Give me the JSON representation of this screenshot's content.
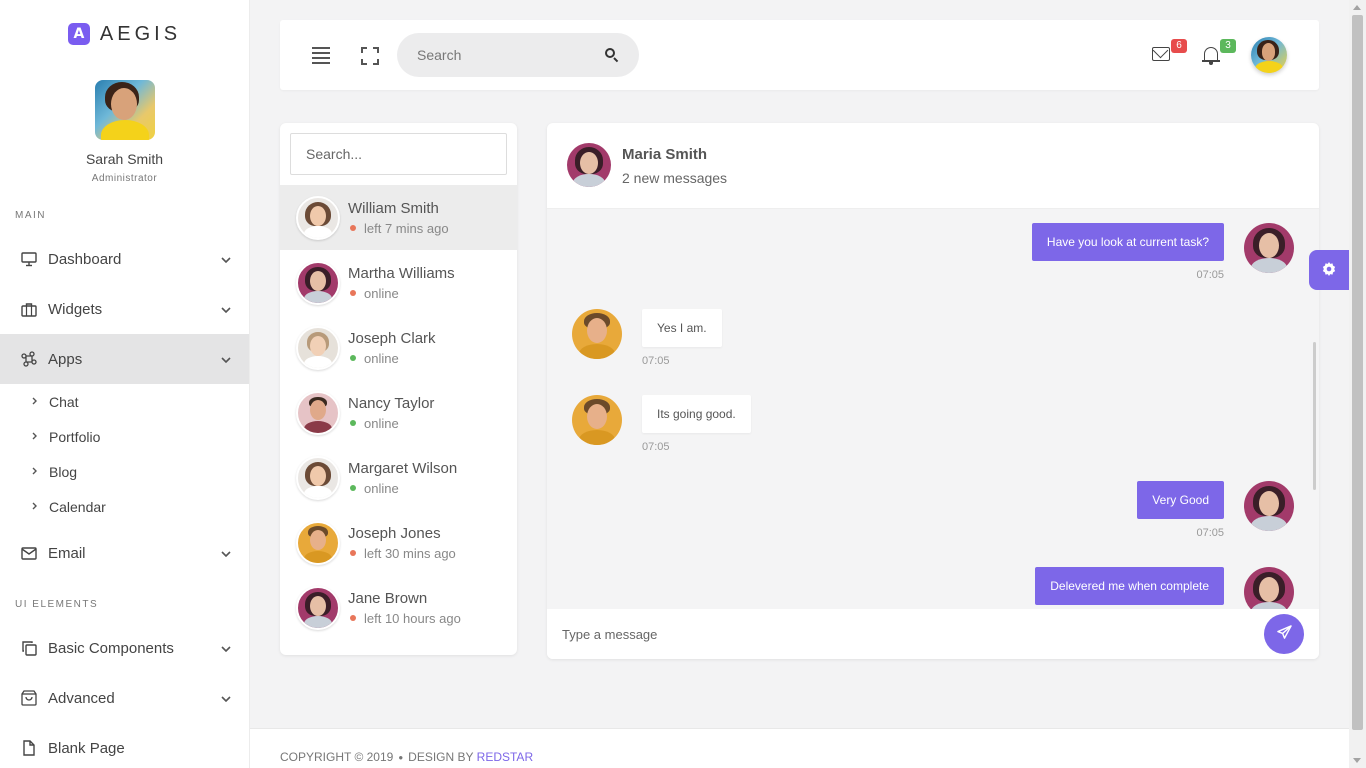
{
  "brand": {
    "logo_letter": "A",
    "name": "AEGIS"
  },
  "profile": {
    "name": "Sarah Smith",
    "role": "Administrator"
  },
  "sidebar": {
    "section_main": "MAIN",
    "section_ui": "UI ELEMENTS",
    "items": [
      {
        "label": "Dashboard",
        "icon": "monitor-icon"
      },
      {
        "label": "Widgets",
        "icon": "briefcase-icon"
      },
      {
        "label": "Apps",
        "icon": "command-icon"
      },
      {
        "label": "Email",
        "icon": "mail-icon"
      },
      {
        "label": "Basic Components",
        "icon": "copy-icon"
      },
      {
        "label": "Advanced",
        "icon": "shopping-bag-icon"
      },
      {
        "label": "Blank Page",
        "icon": "file-icon"
      }
    ],
    "apps_sub": [
      "Chat",
      "Portfolio",
      "Blog",
      "Calendar"
    ]
  },
  "topbar": {
    "search_placeholder": "Search",
    "mail_count": "6",
    "notif_count": "3"
  },
  "contacts": {
    "search_placeholder": "Search...",
    "list": [
      {
        "name": "William Smith",
        "status": "left 7 mins ago",
        "online": false,
        "avatar": "white"
      },
      {
        "name": "Martha Williams",
        "status": "online",
        "online": false,
        "avatar": "pink"
      },
      {
        "name": "Joseph Clark",
        "status": "online",
        "online": true,
        "avatar": "beige"
      },
      {
        "name": "Nancy Taylor",
        "status": "online",
        "online": true,
        "avatar": "rose"
      },
      {
        "name": "Margaret Wilson",
        "status": "online",
        "online": true,
        "avatar": "white"
      },
      {
        "name": "Joseph Jones",
        "status": "left 30 mins ago",
        "online": false,
        "avatar": "yellow"
      },
      {
        "name": "Jane Brown",
        "status": "left 10 hours ago",
        "online": false,
        "avatar": "pink"
      }
    ]
  },
  "chat": {
    "contact_name": "Maria Smith",
    "subtitle": "2 new messages",
    "messages": [
      {
        "text": "Have you look at current task?",
        "time": "07:05",
        "dir": "out"
      },
      {
        "text": "Yes I am.",
        "time": "07:05",
        "dir": "in"
      },
      {
        "text": "Its going good.",
        "time": "07:05",
        "dir": "in"
      },
      {
        "text": "Very Good",
        "time": "07:05",
        "dir": "out"
      },
      {
        "text": "Delevered me when complete",
        "time": "",
        "dir": "out"
      }
    ],
    "input_placeholder": "Type a message"
  },
  "footer": {
    "copyright": "COPYRIGHT © 2019",
    "design_by": "DESIGN BY",
    "link": "REDSTAR"
  },
  "colors": {
    "accent": "#7d67e8",
    "badge_red": "#e74c4c",
    "badge_green": "#5cb85c"
  }
}
